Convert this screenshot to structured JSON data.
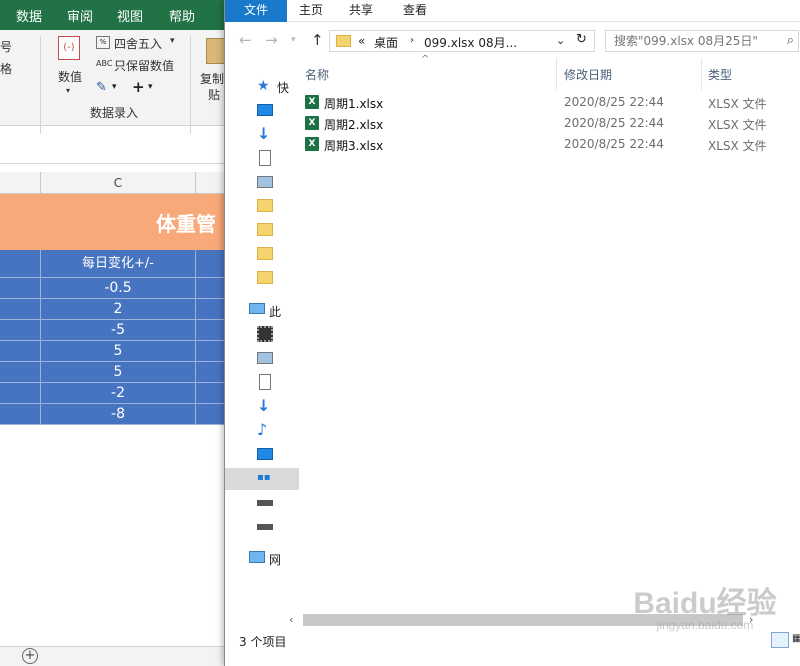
{
  "excel": {
    "tabs": [
      "数据",
      "审阅",
      "视图",
      "帮助"
    ],
    "ribbon": {
      "left_partial_1": "号",
      "left_partial_2": "格",
      "number_label": "数值",
      "round_label": "四舍五入",
      "keep_value_label": "只保留数值",
      "copy_label": "复制",
      "paste_partial": "贴",
      "group_label": "数据录入"
    },
    "column_header": "C",
    "sheet_title": "体重管",
    "table": {
      "header": "每日变化+/-",
      "values": [
        "-0.5",
        "2",
        "-5",
        "5",
        "5",
        "-2",
        "-8"
      ]
    },
    "colors": {
      "tab_bar": "#217346",
      "title_fill": "#f8a97a",
      "table_fill": "#4674c1"
    }
  },
  "explorer": {
    "ribbon_tabs": [
      "文件",
      "主页",
      "共享",
      "查看"
    ],
    "address": {
      "overflow": "«",
      "crumbs": [
        "桌面",
        "099.xlsx 08月..."
      ]
    },
    "search": {
      "placeholder": "搜索\"099.xlsx 08月25日\""
    },
    "nav": {
      "quick_access": "快",
      "this_pc": "此",
      "network": "网"
    },
    "columns": {
      "name": "名称",
      "date": "修改日期",
      "type": "类型"
    },
    "files": [
      {
        "name": "周期1.xlsx",
        "date": "2020/8/25 22:44",
        "type": "XLSX 文件"
      },
      {
        "name": "周期2.xlsx",
        "date": "2020/8/25 22:44",
        "type": "XLSX 文件"
      },
      {
        "name": "周期3.xlsx",
        "date": "2020/8/25 22:44",
        "type": "XLSX 文件"
      }
    ],
    "status": {
      "item_count": "3 个项目"
    },
    "watermark": {
      "brand": "Baidu经验",
      "url": "jingyan.baidu.com"
    },
    "colors": {
      "file_tab": "#1979ca",
      "excel_icon": "#1e7145"
    }
  }
}
